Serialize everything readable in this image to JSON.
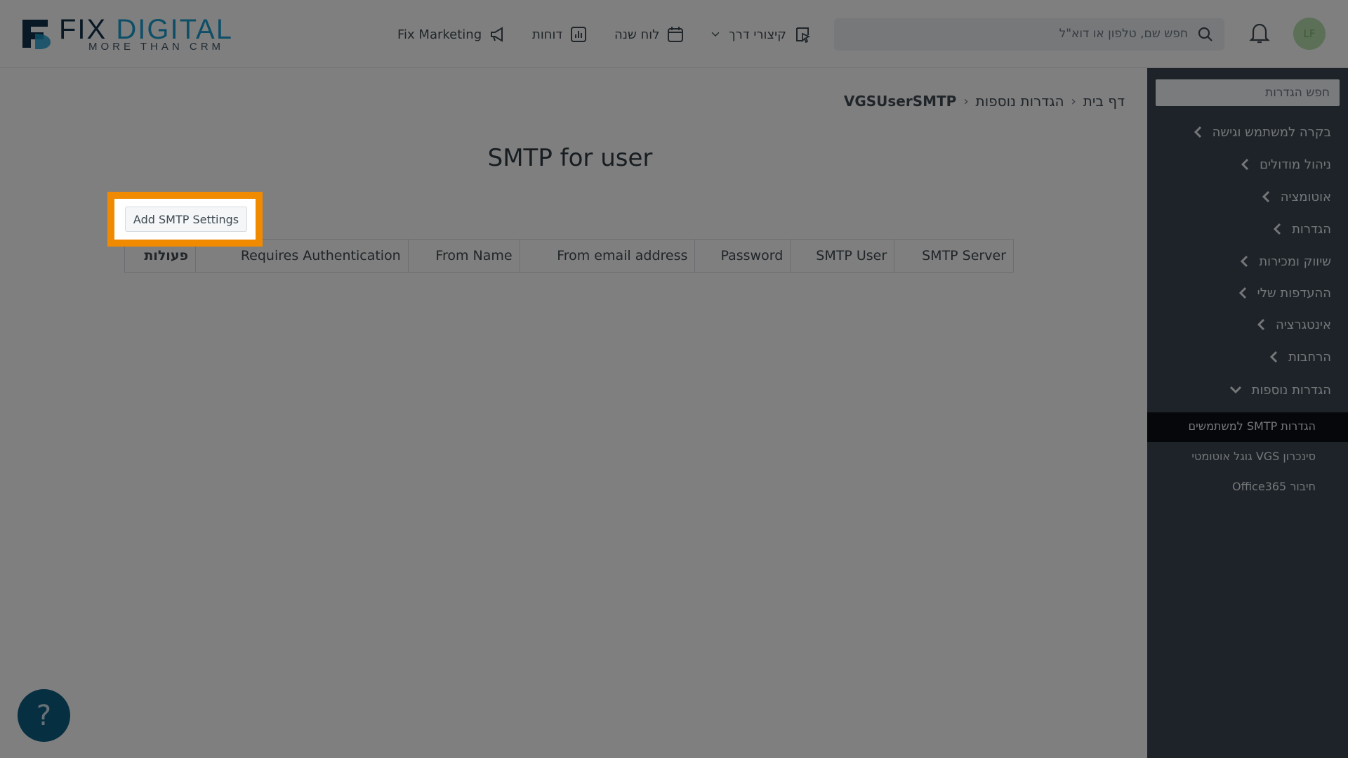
{
  "logo": {
    "word_a": "FIX",
    "word_b": "DIGITAL",
    "tagline": "MORE THAN CRM"
  },
  "nav": {
    "marketing": "Fix Marketing",
    "reports": "דוחות",
    "calendar": "לוח שנה",
    "shortcuts": "קיצורי דרך"
  },
  "search": {
    "placeholder": "חפש שם, טלפון או דוא\"ל"
  },
  "user": {
    "initials": "LF"
  },
  "sidebar": {
    "search_placeholder": "חפש הגדרות",
    "items": [
      {
        "label": "בקרה למשתמש וגישה"
      },
      {
        "label": "ניהול מודולים"
      },
      {
        "label": "אוטומציה"
      },
      {
        "label": "הגדרות"
      },
      {
        "label": "שיווק ומכירות"
      },
      {
        "label": "ההעדפות שלי"
      },
      {
        "label": "אינטגרציה"
      },
      {
        "label": "הרחבות"
      },
      {
        "label": "הגדרות נוספות"
      }
    ],
    "subitems": [
      {
        "label": "הגדרות SMTP למשתמשים",
        "active": true
      },
      {
        "label": "סינכרון VGS גוגל אוטומטי"
      },
      {
        "label": "חיבור Office365"
      }
    ]
  },
  "breadcrumb": {
    "home": "דף בית",
    "parent": "הגדרות נוספות",
    "current": "VGSUserSMTP"
  },
  "page": {
    "title": "SMTP for user",
    "add_button": "Add SMTP Settings"
  },
  "table": {
    "headers": [
      "SMTP Server",
      "SMTP User",
      "Password",
      "From email address",
      "From Name",
      "Requires Authentication",
      "פעולות"
    ]
  },
  "colors": {
    "highlight": "#f08a00",
    "sidebar_bg": "#3a4752",
    "help_bg": "#0e5f84",
    "overlay": "rgba(0,0,0,0.5)"
  }
}
